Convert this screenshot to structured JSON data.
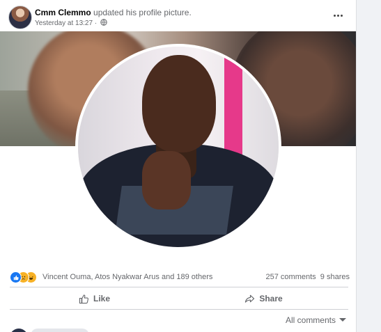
{
  "post": {
    "author": "Cmm Clemmo",
    "action": "updated his profile picture.",
    "timestamp": "Yesterday at 13:27",
    "separator": "·",
    "privacy_icon": "globe-icon",
    "more_icon": "more-dots-icon"
  },
  "reactions": {
    "icons": [
      "like-icon",
      "sad-icon",
      "haha-icon"
    ],
    "reactors": "Vincent Ouma, Atos Nyakwar Arus and 189 others",
    "comments": "257 comments",
    "shares": "9 shares"
  },
  "actions": {
    "like": "Like",
    "share": "Share"
  },
  "comments_filter": "All comments",
  "colors": {
    "accent": "#1877f2",
    "secondary_text": "#65676b",
    "photo_accent": "#e6398a"
  }
}
